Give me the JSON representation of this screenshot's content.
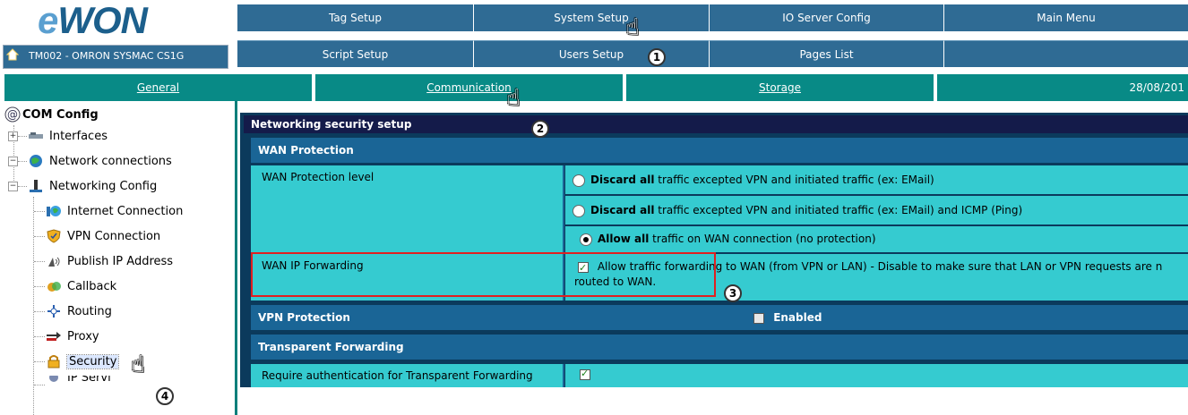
{
  "brand": {
    "logo_text": "eWON"
  },
  "device": {
    "name": "TM002 - OMRON SYSMAC CS1G"
  },
  "top_menu": {
    "row1": [
      "Tag Setup",
      "System Setup",
      "IO Server Config",
      "Main Menu"
    ],
    "row2": [
      "Script Setup",
      "Users Setup",
      "Pages List",
      ""
    ]
  },
  "tabs": [
    "General",
    "Communication",
    "Storage"
  ],
  "date": "28/08/201",
  "tree": {
    "root": "COM Config",
    "items": [
      {
        "label": "Interfaces",
        "icon": "interfaces-icon"
      },
      {
        "label": "Network connections",
        "icon": "network-globe-icon"
      },
      {
        "label": "Networking Config",
        "icon": "networking-config-icon"
      },
      {
        "label": "Internet Connection",
        "icon": "internet-connection-icon"
      },
      {
        "label": "VPN Connection",
        "icon": "vpn-shield-icon"
      },
      {
        "label": "Publish IP Address",
        "icon": "publish-ip-icon"
      },
      {
        "label": "Callback",
        "icon": "callback-icon"
      },
      {
        "label": "Routing",
        "icon": "routing-icon"
      },
      {
        "label": "Proxy",
        "icon": "proxy-icon"
      },
      {
        "label": "Security",
        "icon": "lock-icon"
      },
      {
        "label": "IP Servi",
        "icon": "ip-services-icon"
      }
    ]
  },
  "content": {
    "title": "Networking security setup",
    "wan_protection": {
      "header": "WAN Protection",
      "level_label": "WAN Protection level",
      "options": [
        {
          "bold": "Discard all",
          "rest": " traffic excepted VPN and initiated traffic (ex: EMail)",
          "selected": false
        },
        {
          "bold": "Discard all",
          "rest": " traffic excepted VPN and initiated traffic (ex: EMail) and ICMP (Ping)",
          "selected": false
        },
        {
          "bold": "Allow all",
          "rest": " traffic on WAN connection (no protection)",
          "selected": true
        }
      ],
      "forwarding_label": "WAN IP Forwarding",
      "forwarding_text_1": "Allow traffic forwarding to WAN (from VPN or LAN) - Disable to make sure that LAN or VPN requests are n",
      "forwarding_text_2": "routed to WAN.",
      "forwarding_checked": true
    },
    "vpn_protection": {
      "header": "VPN Protection",
      "enabled_label": "Enabled",
      "enabled": false
    },
    "transparent_forwarding": {
      "header": "Transparent Forwarding",
      "auth_label": "Require authentication for Transparent Forwarding",
      "auth_checked": true
    }
  },
  "annotations": [
    "1",
    "2",
    "3",
    "4"
  ],
  "colors": {
    "nav_blue": "#2f6b94",
    "tab_teal": "#088a86",
    "cell_cyan": "#35cbd0",
    "section_blue": "#1a6596",
    "highlight_red": "#e02020"
  }
}
